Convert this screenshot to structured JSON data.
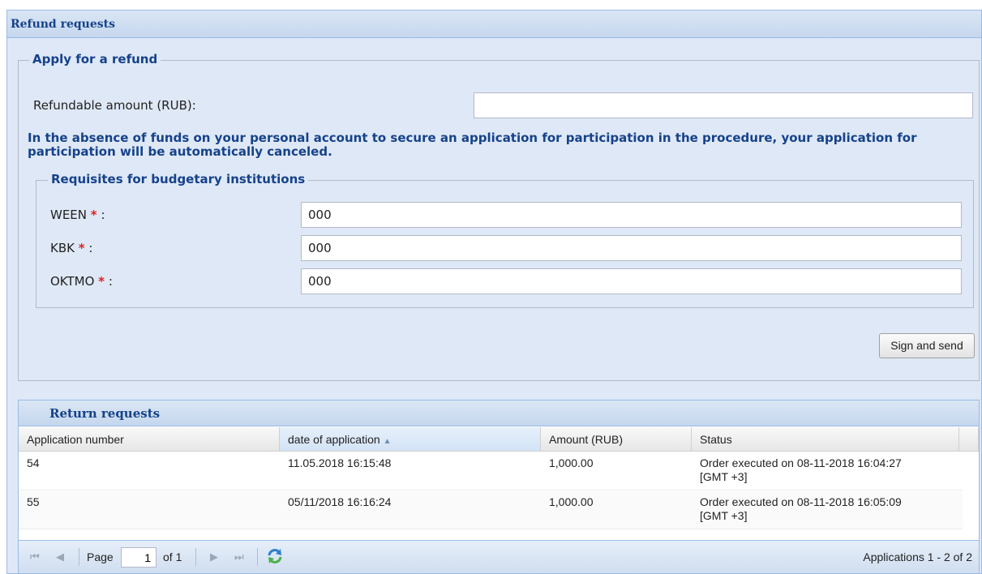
{
  "panel": {
    "title": "Refund requests"
  },
  "apply": {
    "legend": "Apply for a refund",
    "refund_label": "Refundable amount (RUB):",
    "refund_value": "",
    "notice": "In the absence of funds on your personal account to secure an application for participation in the procedure, your application for participation will be automatically canceled."
  },
  "requisites": {
    "legend": "Requisites for budgetary institutions",
    "required_mark": "*",
    "fields": [
      {
        "label": "WEEN",
        "suffix": ":",
        "value": "000"
      },
      {
        "label": "KBK",
        "suffix": ":",
        "value": "000"
      },
      {
        "label": "OKTMO",
        "suffix": ":",
        "value": "000"
      }
    ]
  },
  "sign_button": "Sign and send",
  "grid": {
    "title": "Return requests",
    "columns": [
      "Application number",
      "date of application",
      "Amount (RUB)",
      "Status"
    ],
    "sorted_column": "date of application",
    "rows": [
      {
        "number": "54",
        "date": "11.05.2018 16:15:48",
        "amount": "1,000.00",
        "status_line1": "Order executed on 08-11-2018 16:04:27",
        "status_line2": "[GMT +3]"
      },
      {
        "number": "55",
        "date": "05/11/2018 16:16:24",
        "amount": "1,000.00",
        "status_line1": "Order executed on 08-11-2018 16:05:09",
        "status_line2": "[GMT +3]"
      }
    ]
  },
  "pager": {
    "page_label": "Page",
    "page_value": "1",
    "of_label": "of 1",
    "summary": "Applications 1 - 2 of 2",
    "icons": [
      "first-page-icon",
      "prev-page-icon",
      "next-page-icon",
      "last-page-icon",
      "refresh-icon"
    ]
  },
  "colors": {
    "header_text": "#15428b",
    "panel_bg": "#dfe8f6",
    "border": "#99bbe8",
    "required": "#e02020"
  }
}
